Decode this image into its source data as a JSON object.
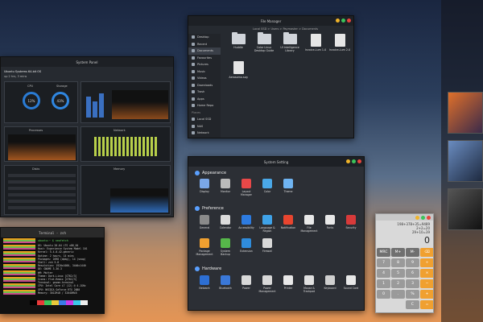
{
  "system_panel": {
    "title": "System Panel",
    "subtitle": "Ubuntu Systems 64-bit OS",
    "uptime": "up 2 hrs, 3 mins",
    "gauges": [
      {
        "label": "CPU",
        "value": "12%"
      },
      {
        "label": "Storage",
        "value": "43%"
      }
    ],
    "sections": [
      "Processes",
      "Network",
      "Disks",
      "Memory"
    ]
  },
  "file_manager": {
    "title": "File Manager",
    "path": "Local SSD > Users > Paymaster > Documents",
    "sidebar": [
      "Desktop",
      "Recent",
      "Documents",
      "Favourites",
      "Pictures",
      "Music",
      "Videos",
      "Downloads",
      "Trash",
      "Apps",
      "Home Repo"
    ],
    "devices_header": "Places",
    "devices": [
      "Local SSD",
      "NAS",
      "Network"
    ],
    "items": [
      {
        "name": "Huddle",
        "type": "folder"
      },
      {
        "name": "Color Linux Desktop Guide",
        "type": "folder"
      },
      {
        "name": "UI Intelligence Library",
        "type": "folder"
      },
      {
        "name": "Invoice-Lum 1.0",
        "type": "file"
      },
      {
        "name": "Invoice-Lum 2.0",
        "type": "file"
      },
      {
        "name": "Aerosomo.svg",
        "type": "file"
      }
    ]
  },
  "settings": {
    "title": "System Setting",
    "appearance": {
      "label": "Appearance",
      "items": [
        {
          "name": "Display",
          "color": "#7aa7e8"
        },
        {
          "name": "Monitor",
          "color": "#bbbbbb"
        },
        {
          "name": "Layout Manager",
          "color": "#e84848"
        },
        {
          "name": "Color",
          "color": "#4aa8e8"
        },
        {
          "name": "Theme",
          "color": "#6fb4f2"
        }
      ]
    },
    "preference": {
      "label": "Preference",
      "items": [
        {
          "name": "General",
          "color": "#8a8a8a"
        },
        {
          "name": "Calendar",
          "color": "#dcdcdc"
        },
        {
          "name": "Accessibility",
          "color": "#2d7be0"
        },
        {
          "name": "Language & Region",
          "color": "#3fa2e8"
        },
        {
          "name": "Notification",
          "color": "#e8452f"
        },
        {
          "name": "File Management",
          "color": "#e8e8e8"
        },
        {
          "name": "Fonts",
          "color": "#e8e8e8"
        },
        {
          "name": "Security",
          "color": "#d83a3a"
        },
        {
          "name": "Package Management",
          "color": "#f0a030"
        },
        {
          "name": "System Backup",
          "color": "#56b74a"
        },
        {
          "name": "Extension",
          "color": "#2f8cdc"
        },
        {
          "name": "Firewall",
          "color": "#d8d8d8"
        }
      ]
    },
    "hardware": {
      "label": "Hardware",
      "items": [
        {
          "name": "Network",
          "color": "#2d6fd4"
        },
        {
          "name": "Bluetooth",
          "color": "#3a78d8"
        },
        {
          "name": "Power",
          "color": "#d8d8d8"
        },
        {
          "name": "Power Management",
          "color": "#d8d8d8"
        },
        {
          "name": "Printer",
          "color": "#e8e8e8"
        },
        {
          "name": "Mouse & Trackpad",
          "color": "#e0e0e0"
        },
        {
          "name": "Keyboard",
          "color": "#cfcfcf"
        },
        {
          "name": "Sound Card",
          "color": "#e8e8e8"
        }
      ]
    }
  },
  "terminal": {
    "title": "Terminal - zsh",
    "prompt": "ubuntu:~ $ neofetch",
    "lines": [
      "OS: Ubuntu 20.04 LTS x86_64",
      "Host: Experience System Model 101",
      "Kernel: 5.4.0-42-generic",
      "Uptime: 2 hours, 14 mins",
      "Packages: 2098 (dpkg), 14 (snap)",
      "Shell: zsh 5.8",
      "Resolution: 1920x1080, 3440x1440",
      "DE: GNOME 3.36.3",
      "WM: Mutter",
      "Theme: Dark-Linux [GTK2/3]",
      "Icons: Flat-Remix [GTK2/3]",
      "Terminal: gnome-terminal",
      "CPU: Intel Core i7 (12) @ 4.1GHz",
      "GPU: NVIDIA GeForce RTX 2080",
      "Memory: 3012MiB / 32048MiB"
    ]
  },
  "calculator": {
    "expression": [
      "198+378+35=9489",
      "2+2=20",
      "29+10=39"
    ],
    "result": "0",
    "buttons": [
      "MRC",
      "M+",
      "M-",
      "⌫",
      "7",
      "8",
      "9",
      "÷",
      "4",
      "5",
      "6",
      "×",
      "1",
      "2",
      "3",
      "−",
      "0",
      ".",
      "%",
      "+",
      "=",
      "C"
    ]
  }
}
